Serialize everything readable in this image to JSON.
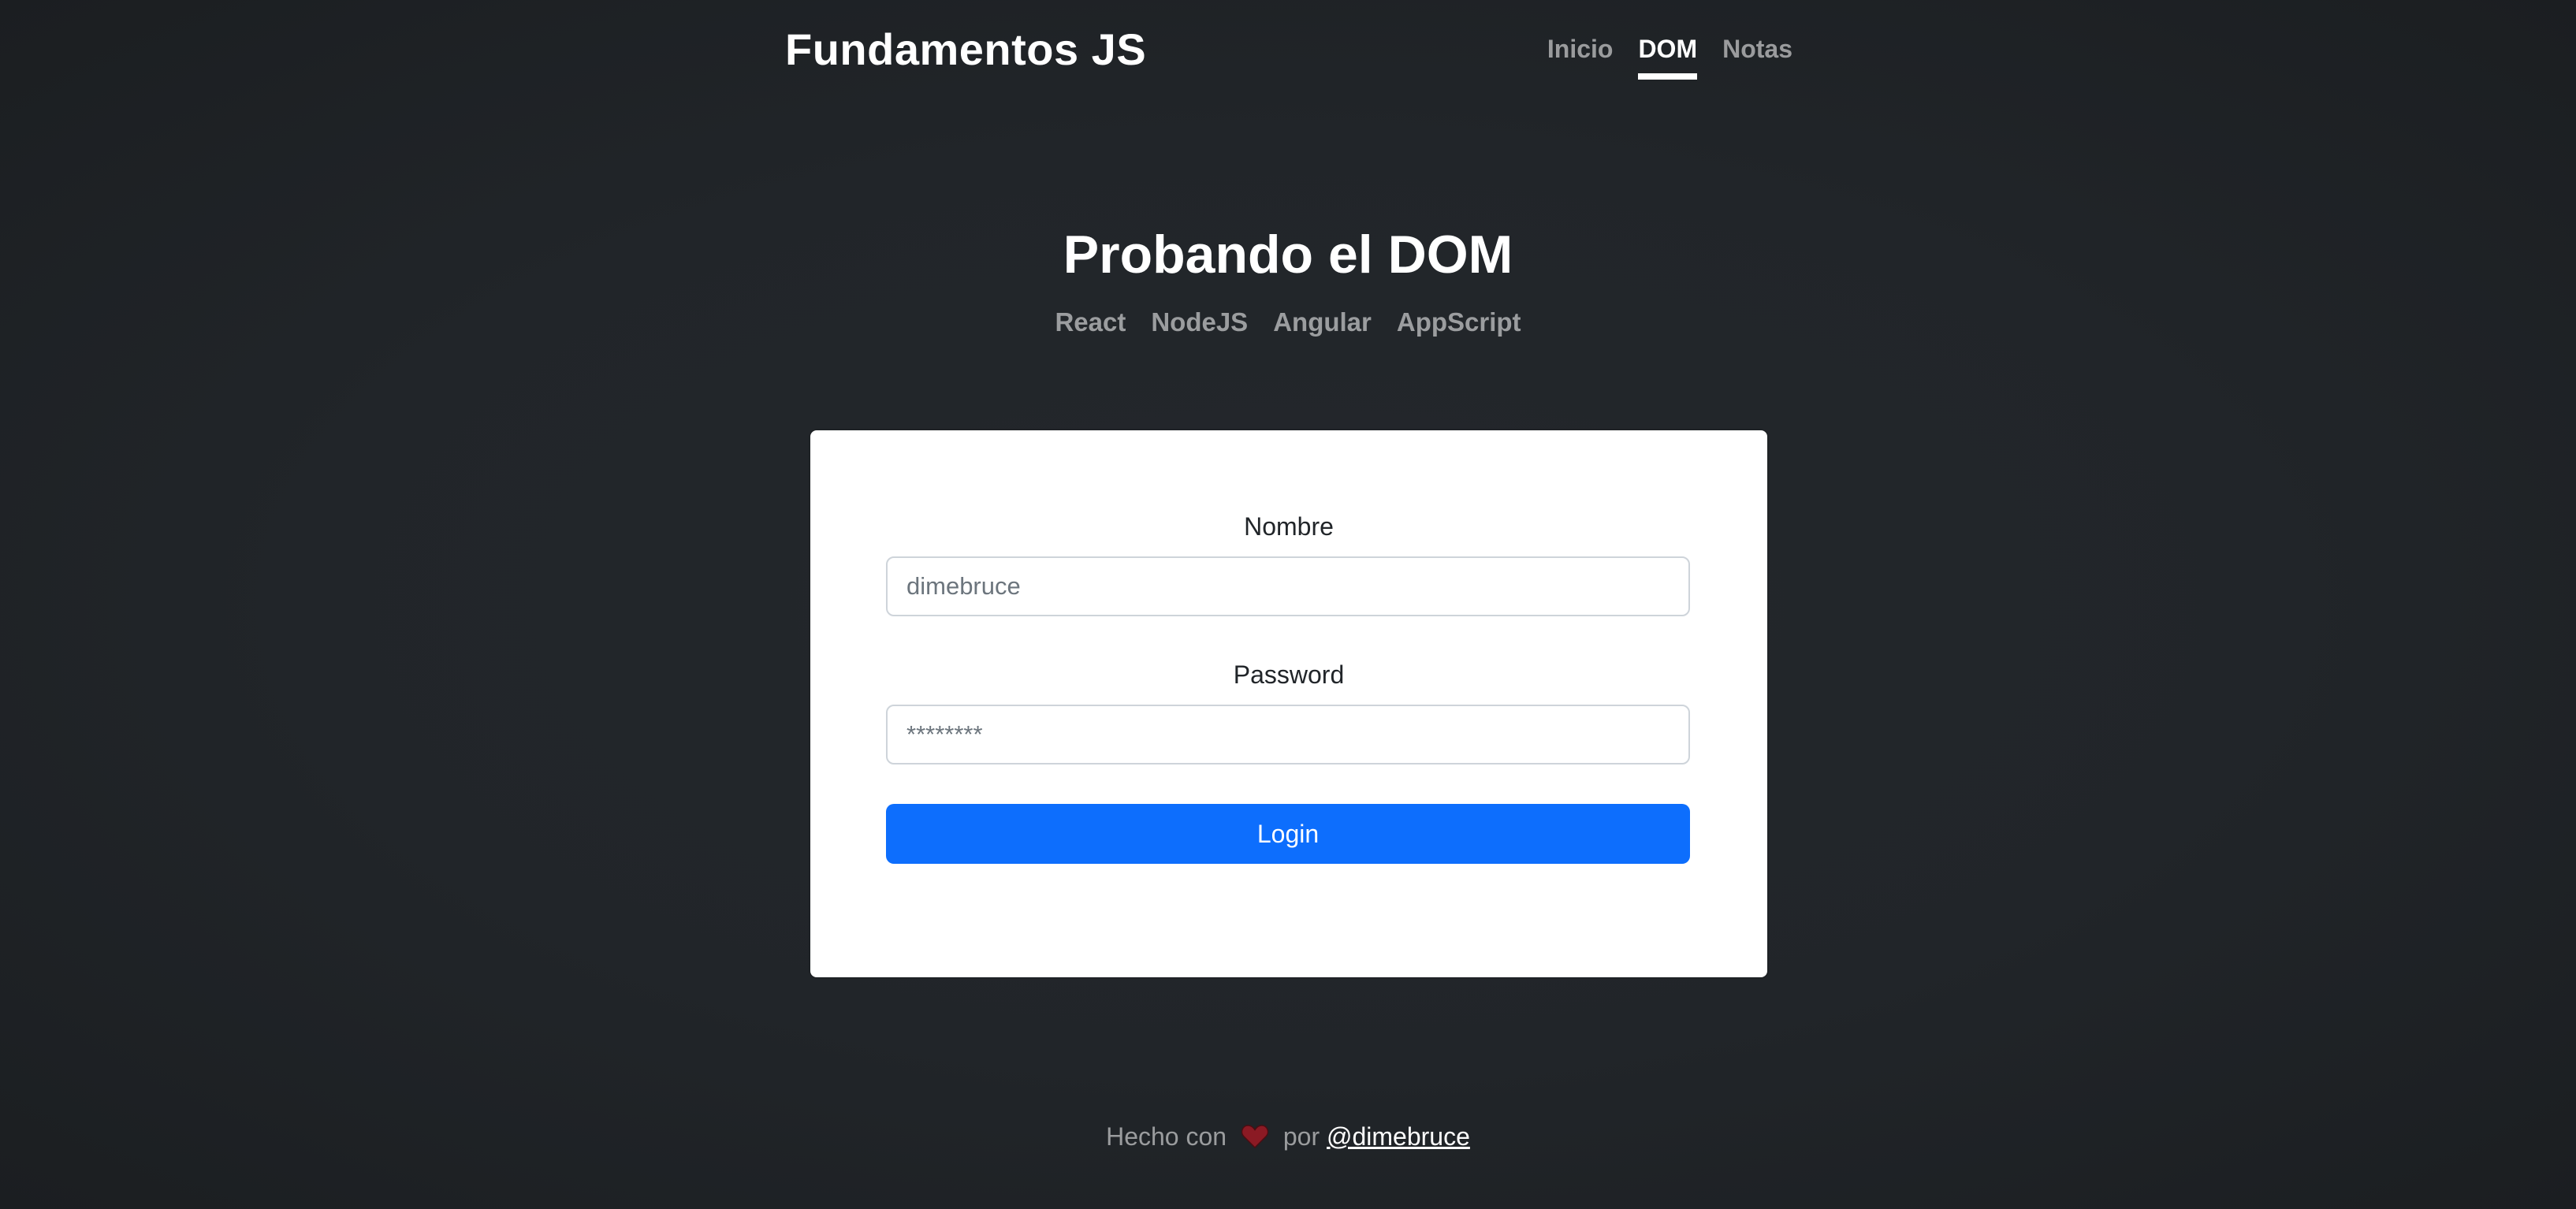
{
  "header": {
    "brand": "Fundamentos JS",
    "nav": [
      {
        "label": "Inicio",
        "active": false
      },
      {
        "label": "DOM",
        "active": true
      },
      {
        "label": "Notas",
        "active": false
      }
    ]
  },
  "hero": {
    "title": "Probando el DOM",
    "technologies": [
      "React",
      "NodeJS",
      "Angular",
      "AppScript"
    ]
  },
  "form": {
    "name_label": "Nombre",
    "name_placeholder": "dimebruce",
    "password_label": "Password",
    "password_placeholder": "********",
    "login_label": "Login"
  },
  "footer": {
    "made_with": "Hecho con",
    "icon": "heart-icon",
    "by": "por",
    "author_link": "@dimebruce"
  },
  "colors": {
    "background": "#212529",
    "primary_button": "#0d6efd",
    "heart": "#8b1a24"
  }
}
